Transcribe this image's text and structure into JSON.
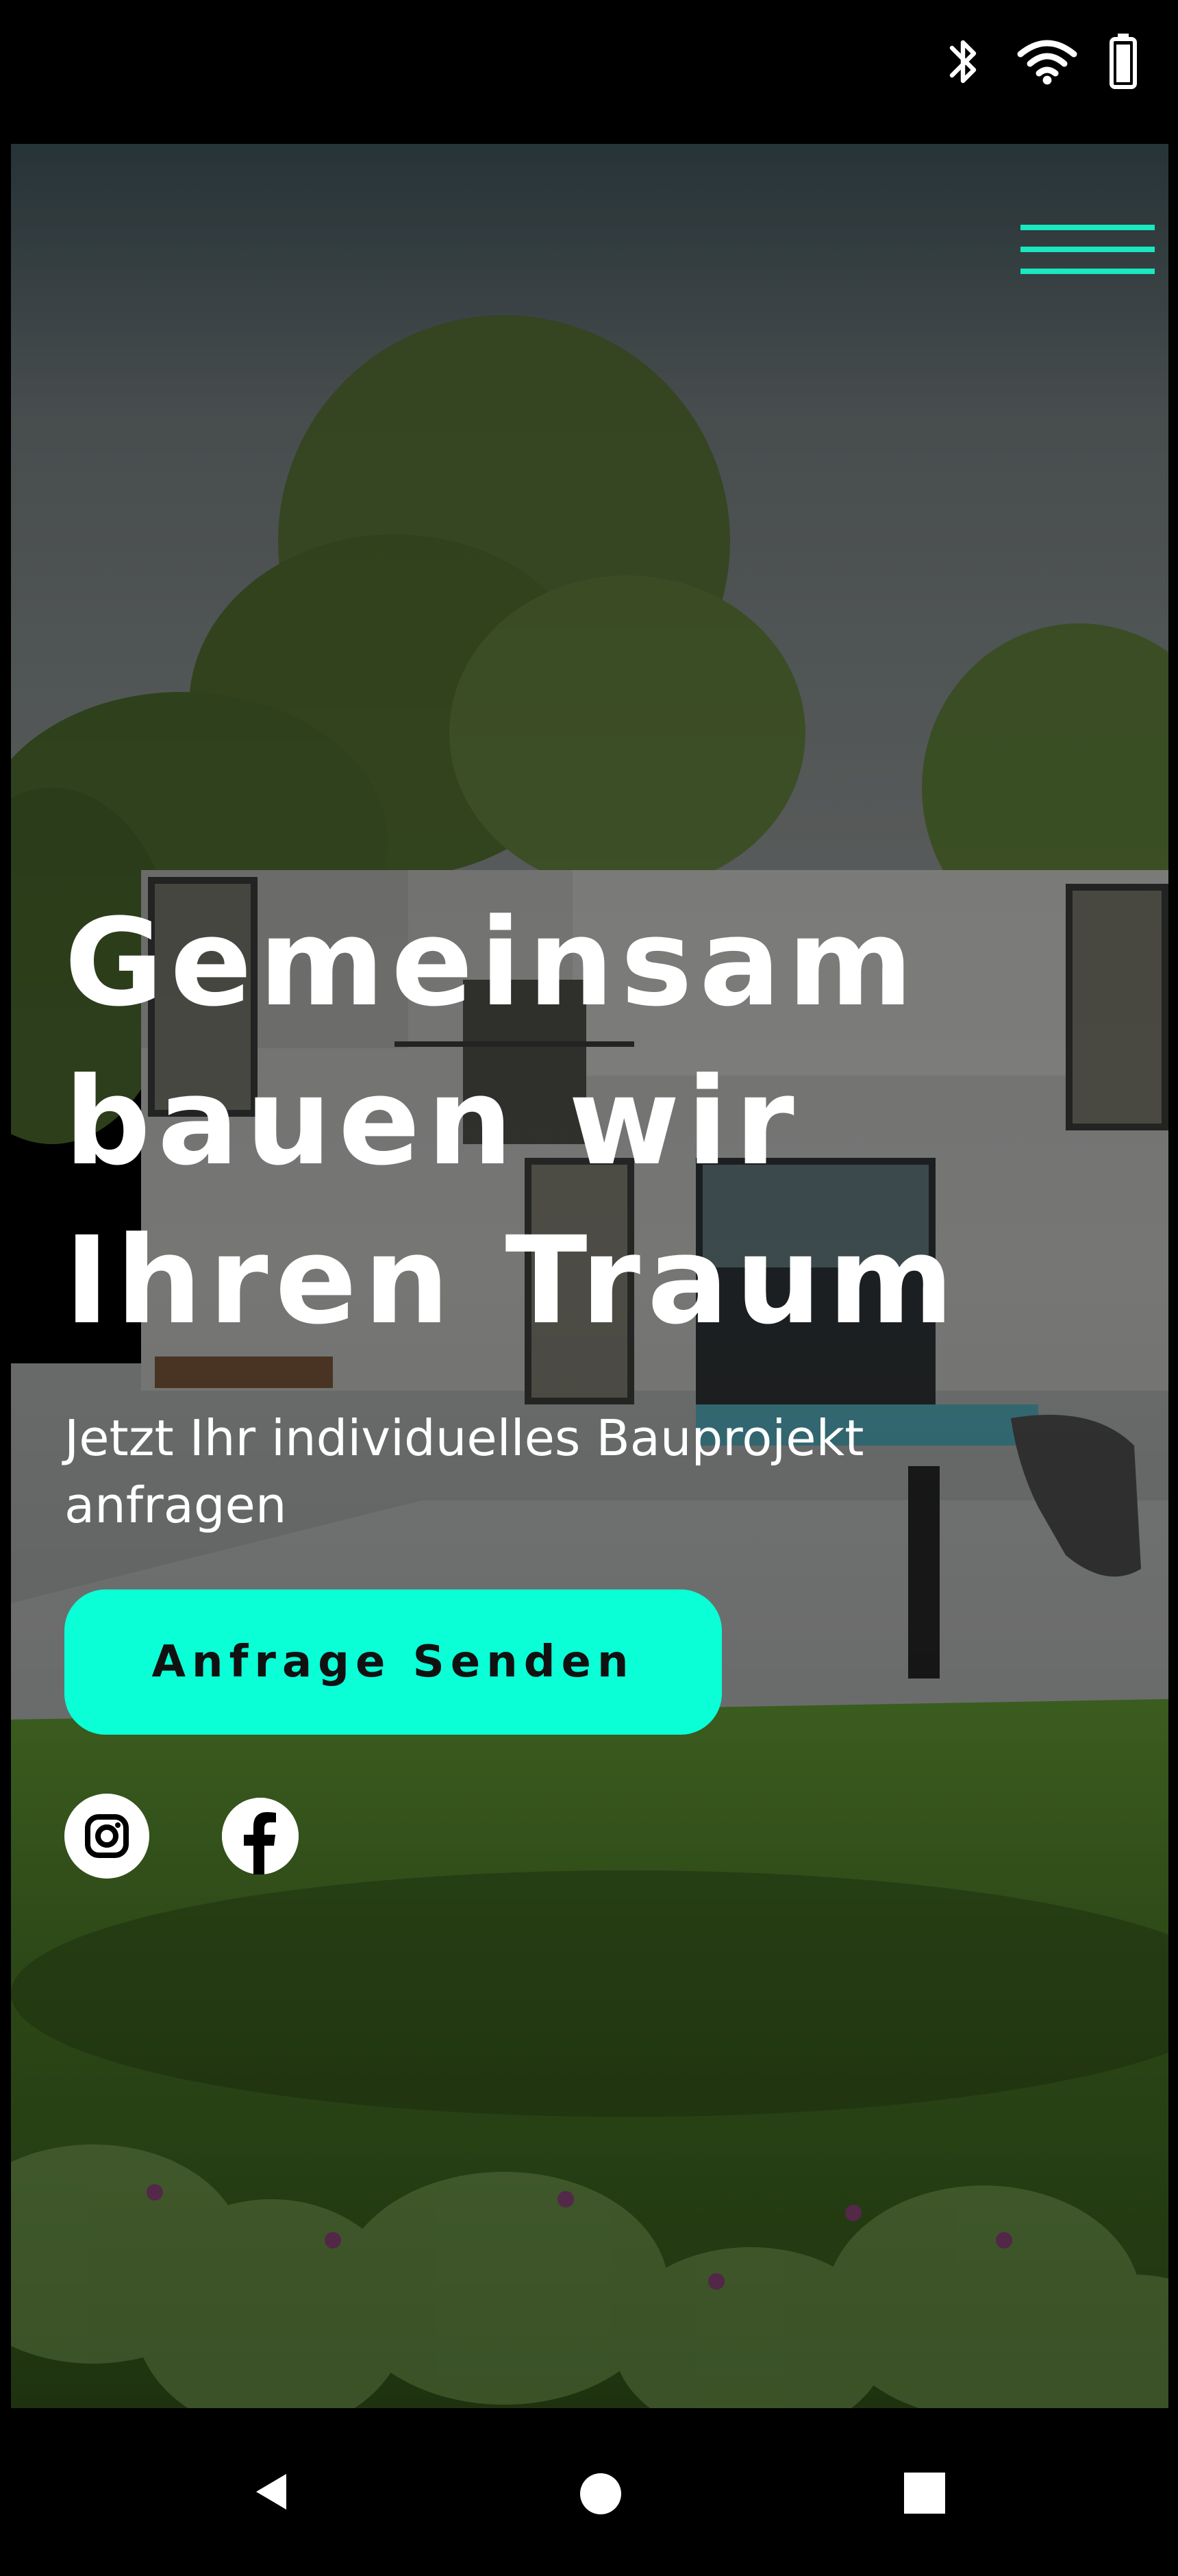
{
  "status_bar": {
    "icons": [
      "bluetooth-icon",
      "wifi-icon",
      "battery-icon"
    ]
  },
  "header": {
    "menu_icon": "hamburger-menu-icon",
    "accent_color": "#19e8c0"
  },
  "hero": {
    "title": "Gemeinsam bauen wir Ihren Traum",
    "subtitle": "Jetzt Ihr individuelles Bauprojekt anfragen",
    "cta_label": "Anfrage Senden",
    "cta_color": "#0bffd6",
    "background_image": "modern concrete house with garden, trees and lawn"
  },
  "social": {
    "items": [
      {
        "icon": "instagram-icon"
      },
      {
        "icon": "facebook-icon"
      }
    ]
  },
  "nav_bar": {
    "buttons": [
      "back-icon",
      "home-icon",
      "recents-icon"
    ]
  }
}
